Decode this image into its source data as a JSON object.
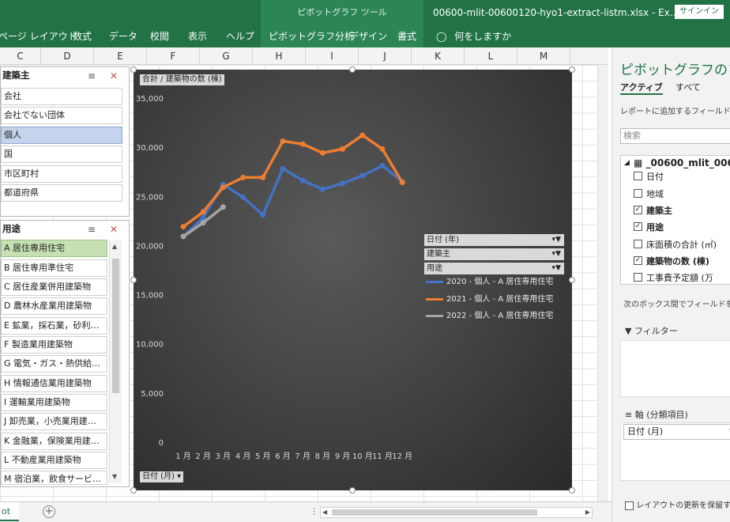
{
  "titlebar": {
    "context_title": "ピボットグラフ ツール",
    "file_title": "00600-mlit-00600120-hyo1-extract-listm.xlsx - Ex…",
    "signin": "サインイン"
  },
  "ribbon": {
    "tabs": [
      "ページ レイアウト",
      "数式",
      "データ",
      "校閲",
      "表示",
      "ヘルプ",
      "ピボットグラフ分析",
      "デザイン",
      "書式"
    ],
    "tell_me": "何をしますか"
  },
  "columns": [
    "C",
    "D",
    "E",
    "F",
    "G",
    "H",
    "I",
    "J",
    "K",
    "L",
    "M"
  ],
  "slicer1": {
    "title": "建築主",
    "items": [
      "会社",
      "会社でない団体",
      "個人",
      "国",
      "市区町村",
      "都道府県"
    ],
    "selected": "個人"
  },
  "slicer2": {
    "title": "用途",
    "items": [
      "A 居住専用住宅",
      "B 居住専用準住宅",
      "C 居住産業併用建築物",
      "D 農林水産業用建築物",
      "E 鉱業，採石業，砂利…",
      "F 製造業用建築物",
      "G 電気・ガス・熱供給…",
      "H 情報通信業用建築物",
      "I 運輸業用建築物",
      "J 卸売業，小売業用建…",
      "K 金融業，保険業用建…",
      "L 不動産業用建築物",
      "M 宿泊業，飲食サービ…"
    ],
    "selected": "A 居住専用住宅"
  },
  "chart": {
    "value_button": "合計 / 建築物の数 (棟)",
    "axis_button": "日付 (月)",
    "field_buttons": [
      "日付 (年)",
      "建築主",
      "用途"
    ],
    "yticks": [
      "35,000",
      "30,000",
      "25,000",
      "20,000",
      "15,000",
      "10,000",
      "5,000",
      "0"
    ]
  },
  "chart_data": {
    "type": "line",
    "categories": [
      "1 月",
      "2 月",
      "3 月",
      "4 月",
      "5 月",
      "6 月",
      "7 月",
      "8 月",
      "9 月",
      "10 月",
      "11 月",
      "12 月"
    ],
    "ylim": [
      0,
      35000
    ],
    "grid": false,
    "legend": "right",
    "series": [
      {
        "name": "2020 - 個人 - A 居住専用住宅",
        "color": "#4472c4",
        "values": [
          21000,
          22900,
          26300,
          25000,
          23200,
          27900,
          26700,
          25800,
          26400,
          27200,
          28200,
          26600
        ]
      },
      {
        "name": "2021 - 個人 - A 居住専用住宅",
        "color": "#ed7d31",
        "values": [
          22000,
          23500,
          26000,
          27000,
          27000,
          30700,
          30400,
          29500,
          29900,
          31300,
          29900,
          26500
        ]
      },
      {
        "name": "2022 - 個人 - A 居住専用住宅",
        "color": "#a5a5a5",
        "values": [
          21000,
          22400,
          24000
        ]
      }
    ]
  },
  "pane": {
    "title": "ピボットグラフのフィ",
    "tab_active": "アクティブ",
    "tab_all": "すべて",
    "desc": "レポートに追加するフィールドを選",
    "search_placeholder": "検索",
    "table_name": "_00600_mlit_006",
    "fields": [
      {
        "label": "日付",
        "checked": false
      },
      {
        "label": "地域",
        "checked": false
      },
      {
        "label": "建築主",
        "checked": true
      },
      {
        "label": "用途",
        "checked": true
      },
      {
        "label": "床面積の合計 (㎡)",
        "checked": false
      },
      {
        "label": "建築物の数 (棟)",
        "checked": true
      },
      {
        "label": "工事費予定額 (万",
        "checked": false
      }
    ],
    "drag_hint": "次のボックス間でフィールドをドラ",
    "filter_label": "フィルター",
    "axis_label": "軸 (分類項目)",
    "axis_field": "日付 (月)",
    "defer": "レイアウトの更新を保留す"
  },
  "sheet": {
    "tab": "ot"
  }
}
